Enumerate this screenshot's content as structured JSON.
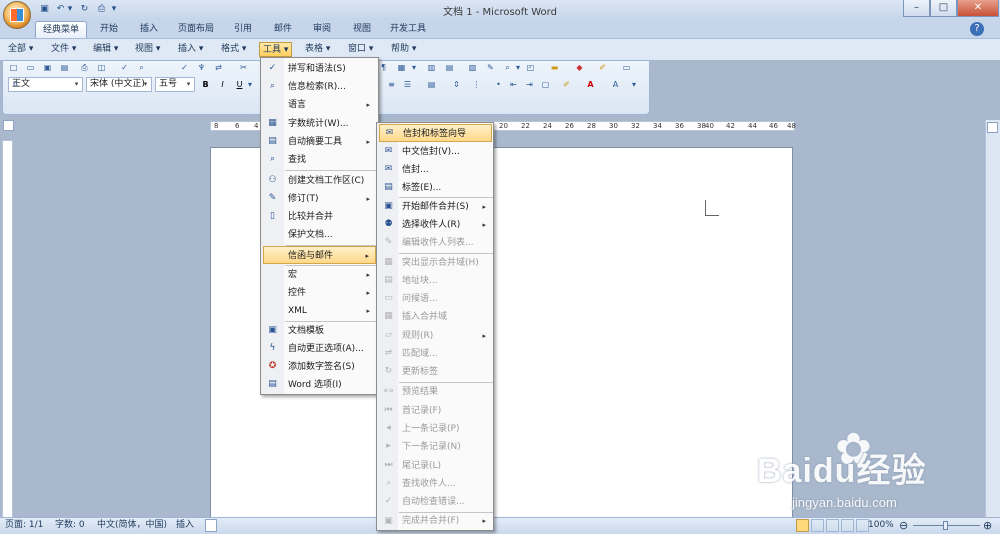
{
  "window": {
    "title": "文档 1 - Microsoft Word",
    "minimize": "–",
    "maximize": "□",
    "close": "✕"
  },
  "ribbon_tabs": [
    "经典菜单",
    "开始",
    "插入",
    "页面布局",
    "引用",
    "邮件",
    "审阅",
    "视图",
    "开发工具"
  ],
  "classic_menu": [
    "全部",
    "文件",
    "编辑",
    "视图",
    "插入",
    "格式",
    "工具",
    "表格",
    "窗口",
    "帮助"
  ],
  "formatting": {
    "style": "正文",
    "font": "宋体 (中文正)",
    "size": "五号"
  },
  "ruler_numbers": [
    "8",
    "6",
    "4",
    "20",
    "22",
    "24",
    "26",
    "28",
    "30",
    "32",
    "34",
    "36",
    "38",
    "40",
    "42",
    "44",
    "46",
    "48"
  ],
  "tools_menu": [
    {
      "label": "拼写和语法(S)",
      "icon": "spell-icon"
    },
    {
      "label": "信息检索(R)...",
      "icon": "research-icon"
    },
    {
      "label": "语言",
      "submenu": true
    },
    {
      "label": "字数统计(W)...",
      "icon": "wordcount-icon"
    },
    {
      "label": "自动摘要工具",
      "submenu": true,
      "icon": "summary-icon"
    },
    {
      "label": "查找",
      "icon": "find-icon"
    },
    {
      "label": "创建文档工作区(C)",
      "icon": "workspace-icon"
    },
    {
      "label": "修订(T)",
      "submenu": true,
      "icon": "track-changes-icon"
    },
    {
      "label": "比较并合并",
      "icon": "compare-icon"
    },
    {
      "label": "保护文档...",
      "icon": ""
    },
    {
      "label": "信函与邮件",
      "submenu": true,
      "highlighted": true
    },
    {
      "label": "宏",
      "submenu": true
    },
    {
      "label": "控件",
      "submenu": true
    },
    {
      "label": "XML",
      "submenu": true
    },
    {
      "label": "文档模板",
      "icon": "template-icon"
    },
    {
      "label": "自动更正选项(A)...",
      "icon": "autocorrect-icon"
    },
    {
      "label": "添加数字签名(S)",
      "icon": "signature-icon"
    },
    {
      "label": "Word 选项(I)",
      "icon": "options-icon"
    }
  ],
  "mail_menu": [
    {
      "label": "信封和标签向导",
      "highlighted": true
    },
    {
      "label": "中文信封(V)..."
    },
    {
      "label": "信封..."
    },
    {
      "label": "标签(E)..."
    },
    {
      "label": "开始邮件合并(S)",
      "submenu": true
    },
    {
      "label": "选择收件人(R)",
      "submenu": true
    },
    {
      "label": "编辑收件人列表...",
      "disabled": true
    },
    {
      "label": "突出显示合并域(H)",
      "disabled": true
    },
    {
      "label": "地址块...",
      "disabled": true
    },
    {
      "label": "问候语...",
      "disabled": true
    },
    {
      "label": "插入合并域",
      "disabled": true
    },
    {
      "label": "规则(R)",
      "disabled": true,
      "submenu": true
    },
    {
      "label": "匹配域...",
      "disabled": true
    },
    {
      "label": "更新标签",
      "disabled": true
    },
    {
      "label": "预览结果",
      "disabled": true
    },
    {
      "label": "首记录(F)",
      "disabled": true
    },
    {
      "label": "上一条记录(P)",
      "disabled": true
    },
    {
      "label": "下一条记录(N)",
      "disabled": true
    },
    {
      "label": "尾记录(L)",
      "disabled": true
    },
    {
      "label": "查找收件人...",
      "disabled": true
    },
    {
      "label": "自动检查错误...",
      "disabled": true
    },
    {
      "label": "完成并合并(F)",
      "disabled": true,
      "submenu": true
    }
  ],
  "status": {
    "page": "页面: 1/1",
    "words": "字数: 0",
    "language": "中文(简体，中国)",
    "mode": "插入",
    "zoom": "100%"
  },
  "watermark": {
    "text": "Baidu经验",
    "sub": "jingyan.baidu.com"
  }
}
